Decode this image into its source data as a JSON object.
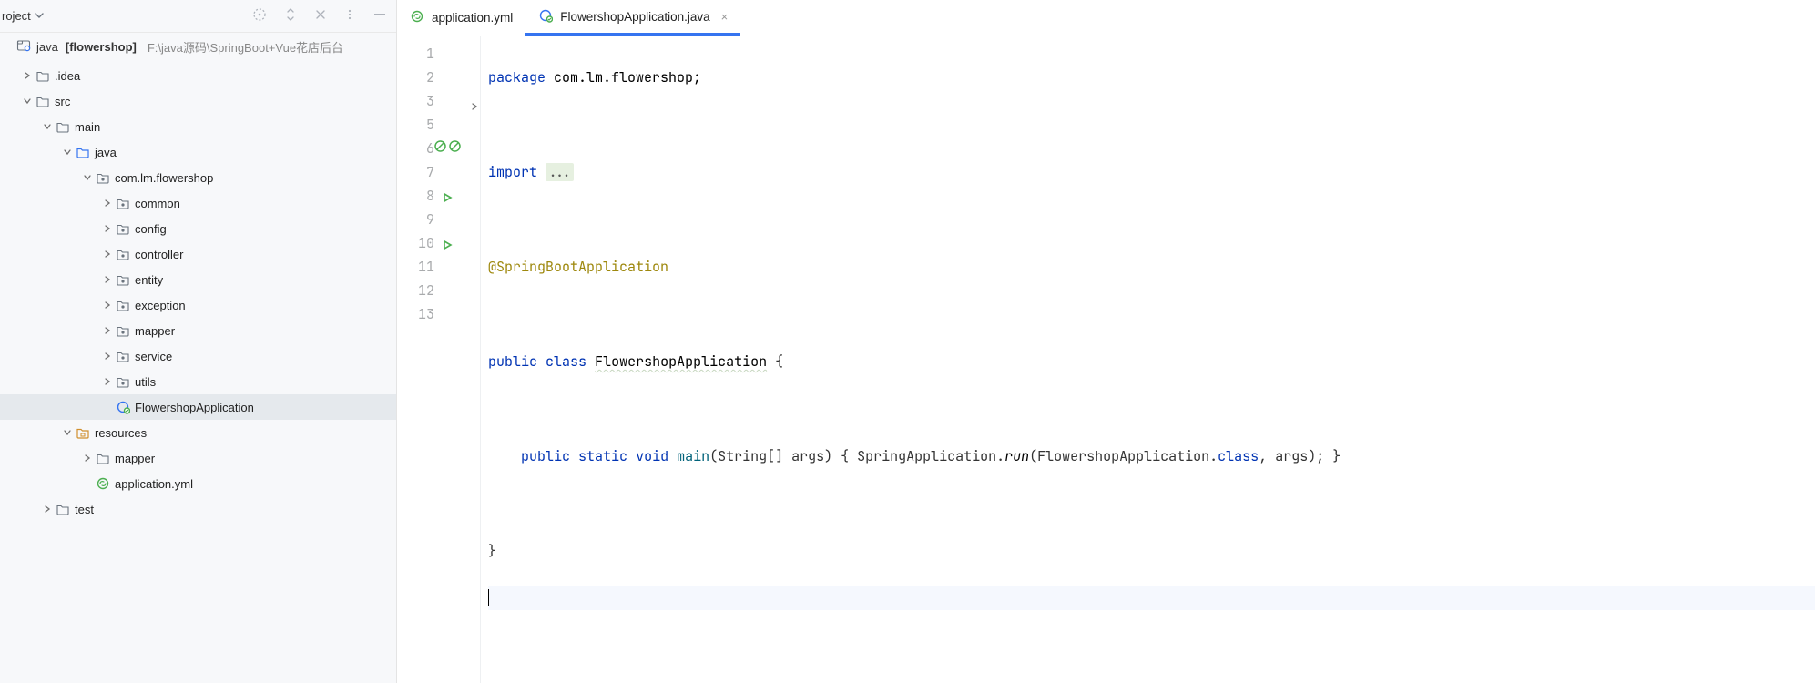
{
  "header": {
    "title": "roject",
    "root_icon": "java-module",
    "root_name": "java",
    "root_bold": "[flowershop]",
    "root_path": "F:\\java源码\\SpringBoot+Vue花店后台"
  },
  "tree": [
    {
      "depth": 0,
      "chev": "r",
      "icon": "folder",
      "label": ".idea"
    },
    {
      "depth": 0,
      "chev": "d",
      "icon": "folder",
      "label": "src"
    },
    {
      "depth": 1,
      "chev": "d",
      "icon": "folder",
      "label": "main"
    },
    {
      "depth": 2,
      "chev": "d",
      "icon": "folder-blue",
      "label": "java"
    },
    {
      "depth": 3,
      "chev": "d",
      "icon": "package",
      "label": "com.lm.flowershop"
    },
    {
      "depth": 4,
      "chev": "r",
      "icon": "package",
      "label": "common"
    },
    {
      "depth": 4,
      "chev": "r",
      "icon": "package",
      "label": "config"
    },
    {
      "depth": 4,
      "chev": "r",
      "icon": "package",
      "label": "controller"
    },
    {
      "depth": 4,
      "chev": "r",
      "icon": "package",
      "label": "entity"
    },
    {
      "depth": 4,
      "chev": "r",
      "icon": "package",
      "label": "exception"
    },
    {
      "depth": 4,
      "chev": "r",
      "icon": "package",
      "label": "mapper"
    },
    {
      "depth": 4,
      "chev": "r",
      "icon": "package",
      "label": "service"
    },
    {
      "depth": 4,
      "chev": "r",
      "icon": "package",
      "label": "utils"
    },
    {
      "depth": 4,
      "chev": "",
      "icon": "java-class",
      "label": "FlowershopApplication",
      "selected": true
    },
    {
      "depth": 2,
      "chev": "d",
      "icon": "folder-res",
      "label": "resources"
    },
    {
      "depth": 3,
      "chev": "r",
      "icon": "folder",
      "label": "mapper"
    },
    {
      "depth": 3,
      "chev": "",
      "icon": "yml",
      "label": "application.yml"
    },
    {
      "depth": 1,
      "chev": "r",
      "icon": "folder",
      "label": "test"
    }
  ],
  "tabs": [
    {
      "icon": "yml",
      "label": "application.yml",
      "close": false,
      "active": false
    },
    {
      "icon": "java-class",
      "label": "FlowershopApplication.java",
      "close": true,
      "active": true
    }
  ],
  "gutter": {
    "lines": [
      "1",
      "2",
      "3",
      "5",
      "6",
      "7",
      "8",
      "9",
      "10",
      "11",
      "12",
      "13"
    ],
    "fold_at": 2,
    "nosmoke_at": 4,
    "run_at": [
      6,
      8
    ]
  },
  "code": {
    "l1_kw": "package",
    "l1_rest": " com.lm.flowershop;",
    "l3_kw": "import",
    "l3_ell": "...",
    "l6_ann": "@SpringBootApplication",
    "l8_pub": "public",
    "l8_cls": "class",
    "l8_name": "FlowershopApplication",
    "l8_brace": " {",
    "l10_indent": "    ",
    "l10_pub": "public",
    "l10_static": "static",
    "l10_void": "void",
    "l10_main": "main",
    "l10_args_open": "(String[] args) { SpringApplication.",
    "l10_run": "run",
    "l10_args_mid": "(FlowershopApplication.",
    "l10_classkw": "class",
    "l10_args_end": ", args); }",
    "l12_brace": "}"
  }
}
